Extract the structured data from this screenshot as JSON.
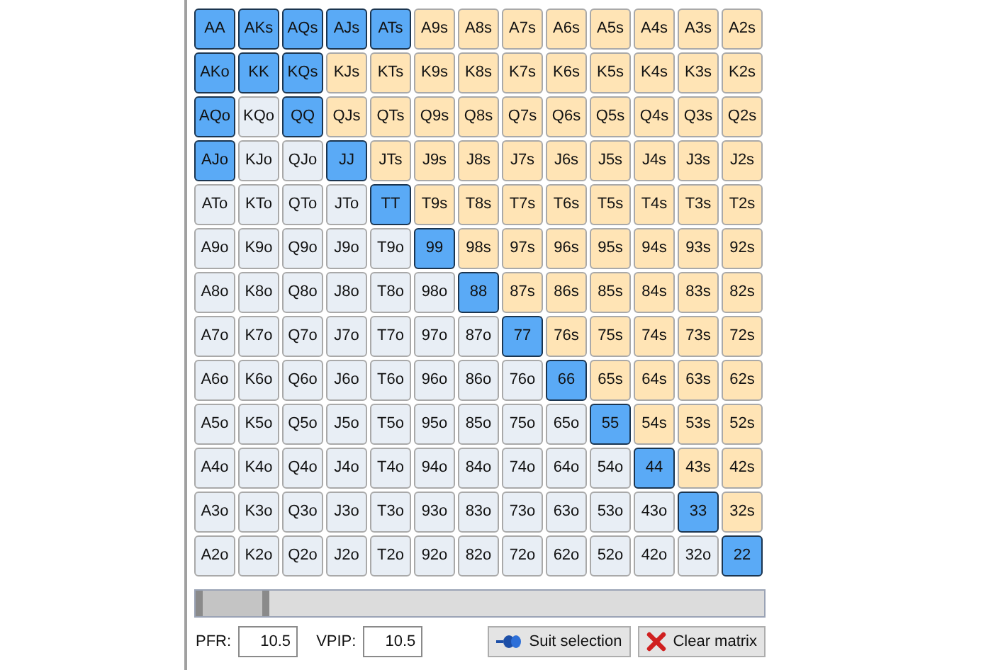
{
  "matrix": {
    "rows": [
      [
        {
          "label": "AA",
          "kind": "pair",
          "selected": true
        },
        {
          "label": "AKs",
          "kind": "suited",
          "selected": true
        },
        {
          "label": "AQs",
          "kind": "suited",
          "selected": true
        },
        {
          "label": "AJs",
          "kind": "suited",
          "selected": true
        },
        {
          "label": "ATs",
          "kind": "suited",
          "selected": true
        },
        {
          "label": "A9s",
          "kind": "suited",
          "selected": false
        },
        {
          "label": "A8s",
          "kind": "suited",
          "selected": false
        },
        {
          "label": "A7s",
          "kind": "suited",
          "selected": false
        },
        {
          "label": "A6s",
          "kind": "suited",
          "selected": false
        },
        {
          "label": "A5s",
          "kind": "suited",
          "selected": false
        },
        {
          "label": "A4s",
          "kind": "suited",
          "selected": false
        },
        {
          "label": "A3s",
          "kind": "suited",
          "selected": false
        },
        {
          "label": "A2s",
          "kind": "suited",
          "selected": false
        }
      ],
      [
        {
          "label": "AKo",
          "kind": "offsuit",
          "selected": true
        },
        {
          "label": "KK",
          "kind": "pair",
          "selected": true
        },
        {
          "label": "KQs",
          "kind": "suited",
          "selected": true
        },
        {
          "label": "KJs",
          "kind": "suited",
          "selected": false
        },
        {
          "label": "KTs",
          "kind": "suited",
          "selected": false
        },
        {
          "label": "K9s",
          "kind": "suited",
          "selected": false
        },
        {
          "label": "K8s",
          "kind": "suited",
          "selected": false
        },
        {
          "label": "K7s",
          "kind": "suited",
          "selected": false
        },
        {
          "label": "K6s",
          "kind": "suited",
          "selected": false
        },
        {
          "label": "K5s",
          "kind": "suited",
          "selected": false
        },
        {
          "label": "K4s",
          "kind": "suited",
          "selected": false
        },
        {
          "label": "K3s",
          "kind": "suited",
          "selected": false
        },
        {
          "label": "K2s",
          "kind": "suited",
          "selected": false
        }
      ],
      [
        {
          "label": "AQo",
          "kind": "offsuit",
          "selected": true
        },
        {
          "label": "KQo",
          "kind": "offsuit",
          "selected": false
        },
        {
          "label": "QQ",
          "kind": "pair",
          "selected": true
        },
        {
          "label": "QJs",
          "kind": "suited",
          "selected": false
        },
        {
          "label": "QTs",
          "kind": "suited",
          "selected": false
        },
        {
          "label": "Q9s",
          "kind": "suited",
          "selected": false
        },
        {
          "label": "Q8s",
          "kind": "suited",
          "selected": false
        },
        {
          "label": "Q7s",
          "kind": "suited",
          "selected": false
        },
        {
          "label": "Q6s",
          "kind": "suited",
          "selected": false
        },
        {
          "label": "Q5s",
          "kind": "suited",
          "selected": false
        },
        {
          "label": "Q4s",
          "kind": "suited",
          "selected": false
        },
        {
          "label": "Q3s",
          "kind": "suited",
          "selected": false
        },
        {
          "label": "Q2s",
          "kind": "suited",
          "selected": false
        }
      ],
      [
        {
          "label": "AJo",
          "kind": "offsuit",
          "selected": true
        },
        {
          "label": "KJo",
          "kind": "offsuit",
          "selected": false
        },
        {
          "label": "QJo",
          "kind": "offsuit",
          "selected": false
        },
        {
          "label": "JJ",
          "kind": "pair",
          "selected": true
        },
        {
          "label": "JTs",
          "kind": "suited",
          "selected": false
        },
        {
          "label": "J9s",
          "kind": "suited",
          "selected": false
        },
        {
          "label": "J8s",
          "kind": "suited",
          "selected": false
        },
        {
          "label": "J7s",
          "kind": "suited",
          "selected": false
        },
        {
          "label": "J6s",
          "kind": "suited",
          "selected": false
        },
        {
          "label": "J5s",
          "kind": "suited",
          "selected": false
        },
        {
          "label": "J4s",
          "kind": "suited",
          "selected": false
        },
        {
          "label": "J3s",
          "kind": "suited",
          "selected": false
        },
        {
          "label": "J2s",
          "kind": "suited",
          "selected": false
        }
      ],
      [
        {
          "label": "ATo",
          "kind": "offsuit",
          "selected": false
        },
        {
          "label": "KTo",
          "kind": "offsuit",
          "selected": false
        },
        {
          "label": "QTo",
          "kind": "offsuit",
          "selected": false
        },
        {
          "label": "JTo",
          "kind": "offsuit",
          "selected": false
        },
        {
          "label": "TT",
          "kind": "pair",
          "selected": true
        },
        {
          "label": "T9s",
          "kind": "suited",
          "selected": false
        },
        {
          "label": "T8s",
          "kind": "suited",
          "selected": false
        },
        {
          "label": "T7s",
          "kind": "suited",
          "selected": false
        },
        {
          "label": "T6s",
          "kind": "suited",
          "selected": false
        },
        {
          "label": "T5s",
          "kind": "suited",
          "selected": false
        },
        {
          "label": "T4s",
          "kind": "suited",
          "selected": false
        },
        {
          "label": "T3s",
          "kind": "suited",
          "selected": false
        },
        {
          "label": "T2s",
          "kind": "suited",
          "selected": false
        }
      ],
      [
        {
          "label": "A9o",
          "kind": "offsuit",
          "selected": false
        },
        {
          "label": "K9o",
          "kind": "offsuit",
          "selected": false
        },
        {
          "label": "Q9o",
          "kind": "offsuit",
          "selected": false
        },
        {
          "label": "J9o",
          "kind": "offsuit",
          "selected": false
        },
        {
          "label": "T9o",
          "kind": "offsuit",
          "selected": false
        },
        {
          "label": "99",
          "kind": "pair",
          "selected": true
        },
        {
          "label": "98s",
          "kind": "suited",
          "selected": false
        },
        {
          "label": "97s",
          "kind": "suited",
          "selected": false
        },
        {
          "label": "96s",
          "kind": "suited",
          "selected": false
        },
        {
          "label": "95s",
          "kind": "suited",
          "selected": false
        },
        {
          "label": "94s",
          "kind": "suited",
          "selected": false
        },
        {
          "label": "93s",
          "kind": "suited",
          "selected": false
        },
        {
          "label": "92s",
          "kind": "suited",
          "selected": false
        }
      ],
      [
        {
          "label": "A8o",
          "kind": "offsuit",
          "selected": false
        },
        {
          "label": "K8o",
          "kind": "offsuit",
          "selected": false
        },
        {
          "label": "Q8o",
          "kind": "offsuit",
          "selected": false
        },
        {
          "label": "J8o",
          "kind": "offsuit",
          "selected": false
        },
        {
          "label": "T8o",
          "kind": "offsuit",
          "selected": false
        },
        {
          "label": "98o",
          "kind": "offsuit",
          "selected": false
        },
        {
          "label": "88",
          "kind": "pair",
          "selected": true
        },
        {
          "label": "87s",
          "kind": "suited",
          "selected": false
        },
        {
          "label": "86s",
          "kind": "suited",
          "selected": false
        },
        {
          "label": "85s",
          "kind": "suited",
          "selected": false
        },
        {
          "label": "84s",
          "kind": "suited",
          "selected": false
        },
        {
          "label": "83s",
          "kind": "suited",
          "selected": false
        },
        {
          "label": "82s",
          "kind": "suited",
          "selected": false
        }
      ],
      [
        {
          "label": "A7o",
          "kind": "offsuit",
          "selected": false
        },
        {
          "label": "K7o",
          "kind": "offsuit",
          "selected": false
        },
        {
          "label": "Q7o",
          "kind": "offsuit",
          "selected": false
        },
        {
          "label": "J7o",
          "kind": "offsuit",
          "selected": false
        },
        {
          "label": "T7o",
          "kind": "offsuit",
          "selected": false
        },
        {
          "label": "97o",
          "kind": "offsuit",
          "selected": false
        },
        {
          "label": "87o",
          "kind": "offsuit",
          "selected": false
        },
        {
          "label": "77",
          "kind": "pair",
          "selected": true
        },
        {
          "label": "76s",
          "kind": "suited",
          "selected": false
        },
        {
          "label": "75s",
          "kind": "suited",
          "selected": false
        },
        {
          "label": "74s",
          "kind": "suited",
          "selected": false
        },
        {
          "label": "73s",
          "kind": "suited",
          "selected": false
        },
        {
          "label": "72s",
          "kind": "suited",
          "selected": false
        }
      ],
      [
        {
          "label": "A6o",
          "kind": "offsuit",
          "selected": false
        },
        {
          "label": "K6o",
          "kind": "offsuit",
          "selected": false
        },
        {
          "label": "Q6o",
          "kind": "offsuit",
          "selected": false
        },
        {
          "label": "J6o",
          "kind": "offsuit",
          "selected": false
        },
        {
          "label": "T6o",
          "kind": "offsuit",
          "selected": false
        },
        {
          "label": "96o",
          "kind": "offsuit",
          "selected": false
        },
        {
          "label": "86o",
          "kind": "offsuit",
          "selected": false
        },
        {
          "label": "76o",
          "kind": "offsuit",
          "selected": false
        },
        {
          "label": "66",
          "kind": "pair",
          "selected": true
        },
        {
          "label": "65s",
          "kind": "suited",
          "selected": false
        },
        {
          "label": "64s",
          "kind": "suited",
          "selected": false
        },
        {
          "label": "63s",
          "kind": "suited",
          "selected": false
        },
        {
          "label": "62s",
          "kind": "suited",
          "selected": false
        }
      ],
      [
        {
          "label": "A5o",
          "kind": "offsuit",
          "selected": false
        },
        {
          "label": "K5o",
          "kind": "offsuit",
          "selected": false
        },
        {
          "label": "Q5o",
          "kind": "offsuit",
          "selected": false
        },
        {
          "label": "J5o",
          "kind": "offsuit",
          "selected": false
        },
        {
          "label": "T5o",
          "kind": "offsuit",
          "selected": false
        },
        {
          "label": "95o",
          "kind": "offsuit",
          "selected": false
        },
        {
          "label": "85o",
          "kind": "offsuit",
          "selected": false
        },
        {
          "label": "75o",
          "kind": "offsuit",
          "selected": false
        },
        {
          "label": "65o",
          "kind": "offsuit",
          "selected": false
        },
        {
          "label": "55",
          "kind": "pair",
          "selected": true
        },
        {
          "label": "54s",
          "kind": "suited",
          "selected": false
        },
        {
          "label": "53s",
          "kind": "suited",
          "selected": false
        },
        {
          "label": "52s",
          "kind": "suited",
          "selected": false
        }
      ],
      [
        {
          "label": "A4o",
          "kind": "offsuit",
          "selected": false
        },
        {
          "label": "K4o",
          "kind": "offsuit",
          "selected": false
        },
        {
          "label": "Q4o",
          "kind": "offsuit",
          "selected": false
        },
        {
          "label": "J4o",
          "kind": "offsuit",
          "selected": false
        },
        {
          "label": "T4o",
          "kind": "offsuit",
          "selected": false
        },
        {
          "label": "94o",
          "kind": "offsuit",
          "selected": false
        },
        {
          "label": "84o",
          "kind": "offsuit",
          "selected": false
        },
        {
          "label": "74o",
          "kind": "offsuit",
          "selected": false
        },
        {
          "label": "64o",
          "kind": "offsuit",
          "selected": false
        },
        {
          "label": "54o",
          "kind": "offsuit",
          "selected": false
        },
        {
          "label": "44",
          "kind": "pair",
          "selected": true
        },
        {
          "label": "43s",
          "kind": "suited",
          "selected": false
        },
        {
          "label": "42s",
          "kind": "suited",
          "selected": false
        }
      ],
      [
        {
          "label": "A3o",
          "kind": "offsuit",
          "selected": false
        },
        {
          "label": "K3o",
          "kind": "offsuit",
          "selected": false
        },
        {
          "label": "Q3o",
          "kind": "offsuit",
          "selected": false
        },
        {
          "label": "J3o",
          "kind": "offsuit",
          "selected": false
        },
        {
          "label": "T3o",
          "kind": "offsuit",
          "selected": false
        },
        {
          "label": "93o",
          "kind": "offsuit",
          "selected": false
        },
        {
          "label": "83o",
          "kind": "offsuit",
          "selected": false
        },
        {
          "label": "73o",
          "kind": "offsuit",
          "selected": false
        },
        {
          "label": "63o",
          "kind": "offsuit",
          "selected": false
        },
        {
          "label": "53o",
          "kind": "offsuit",
          "selected": false
        },
        {
          "label": "43o",
          "kind": "offsuit",
          "selected": false
        },
        {
          "label": "33",
          "kind": "pair",
          "selected": true
        },
        {
          "label": "32s",
          "kind": "suited",
          "selected": false
        }
      ],
      [
        {
          "label": "A2o",
          "kind": "offsuit",
          "selected": false
        },
        {
          "label": "K2o",
          "kind": "offsuit",
          "selected": false
        },
        {
          "label": "Q2o",
          "kind": "offsuit",
          "selected": false
        },
        {
          "label": "J2o",
          "kind": "offsuit",
          "selected": false
        },
        {
          "label": "T2o",
          "kind": "offsuit",
          "selected": false
        },
        {
          "label": "92o",
          "kind": "offsuit",
          "selected": false
        },
        {
          "label": "82o",
          "kind": "offsuit",
          "selected": false
        },
        {
          "label": "72o",
          "kind": "offsuit",
          "selected": false
        },
        {
          "label": "62o",
          "kind": "offsuit",
          "selected": false
        },
        {
          "label": "52o",
          "kind": "offsuit",
          "selected": false
        },
        {
          "label": "42o",
          "kind": "offsuit",
          "selected": false
        },
        {
          "label": "32o",
          "kind": "offsuit",
          "selected": false
        },
        {
          "label": "22",
          "kind": "pair",
          "selected": true
        }
      ]
    ]
  },
  "range_slider": {
    "level": 0.13
  },
  "pfr": {
    "label": "PFR:",
    "value": "10.5"
  },
  "vpip": {
    "label": "VPIP:",
    "value": "10.5"
  },
  "buttons": [
    {
      "kind": "suit",
      "label": "Suit selection"
    },
    {
      "kind": "clear",
      "label": "Clear matrix"
    }
  ]
}
